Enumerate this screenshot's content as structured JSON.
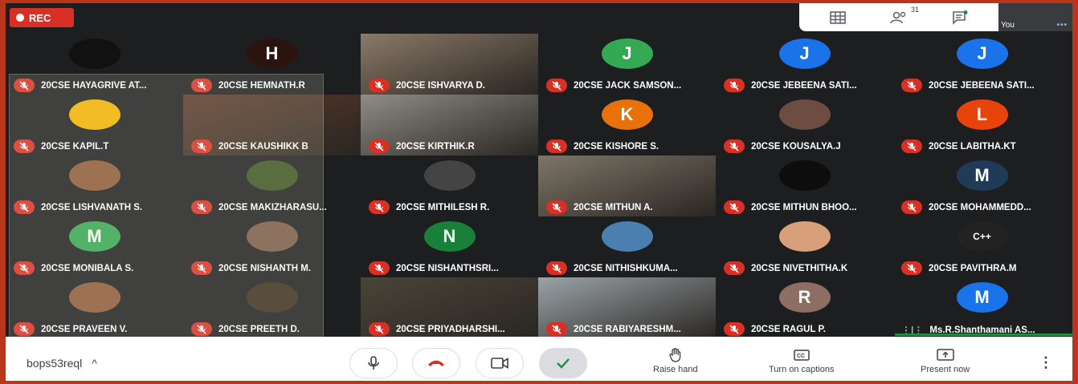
{
  "rec_label": "REC",
  "participant_count": "31",
  "self_label": "You",
  "self_dots": "•••",
  "meeting_code": "bops53reql",
  "chevron": "^",
  "actions": {
    "raise_hand": "Raise hand",
    "captions": "Turn on captions",
    "present": "Present now"
  },
  "tiles": [
    {
      "name": "20CSE HAYAGRIVE AT...",
      "col": 0,
      "row": 0,
      "kind": "avatar",
      "color": "#111111",
      "letter": ""
    },
    {
      "name": "20CSE HEMNATH.R",
      "col": 1,
      "row": 0,
      "kind": "avatar",
      "color": "#2b1410",
      "letter": "H"
    },
    {
      "name": "20CSE ISHVARYA D.",
      "col": 2,
      "row": 0,
      "kind": "video",
      "color": "#8a7a68",
      "letter": ""
    },
    {
      "name": "20CSE JACK SAMSON...",
      "col": 3,
      "row": 0,
      "kind": "avatar",
      "color": "#34a853",
      "letter": "J"
    },
    {
      "name": "20CSE JEBEENA SATI...",
      "col": 4,
      "row": 0,
      "kind": "avatar",
      "color": "#1a73e8",
      "letter": "J"
    },
    {
      "name": "20CSE JEBEENA SATI...",
      "col": 5,
      "row": 0,
      "kind": "avatar",
      "color": "#1a73e8",
      "letter": "J"
    },
    {
      "name": "20CSE KAPIL.T",
      "col": 0,
      "row": 1,
      "kind": "avatar",
      "color": "#f4b400",
      "letter": ""
    },
    {
      "name": "20CSE KAUSHIKK B",
      "col": 1,
      "row": 1,
      "kind": "video",
      "color": "#5c3a2c",
      "letter": ""
    },
    {
      "name": "20CSE KIRTHIK.R",
      "col": 2,
      "row": 1,
      "kind": "video",
      "color": "#8f8d88",
      "letter": ""
    },
    {
      "name": "20CSE KISHORE S.",
      "col": 3,
      "row": 1,
      "kind": "avatar",
      "color": "#e8710a",
      "letter": "K"
    },
    {
      "name": "20CSE KOUSALYA.J",
      "col": 4,
      "row": 1,
      "kind": "avatar",
      "color": "#6d4c41",
      "letter": ""
    },
    {
      "name": "20CSE LABITHA.KT",
      "col": 5,
      "row": 1,
      "kind": "avatar",
      "color": "#e8430a",
      "letter": "L"
    },
    {
      "name": "20CSE LISHVANATH S.",
      "col": 0,
      "row": 2,
      "kind": "avatar",
      "color": "#8d5a3a",
      "letter": ""
    },
    {
      "name": "20CSE MAKIZHARASU...",
      "col": 1,
      "row": 2,
      "kind": "avatar",
      "color": "#3b5323",
      "letter": ""
    },
    {
      "name": "20CSE MITHILESH R.",
      "col": 2,
      "row": 2,
      "kind": "avatar",
      "color": "#444444",
      "letter": ""
    },
    {
      "name": "20CSE MITHUN A.",
      "col": 3,
      "row": 2,
      "kind": "video",
      "color": "#7d7568",
      "letter": ""
    },
    {
      "name": "20CSE MITHUN BHOO...",
      "col": 4,
      "row": 2,
      "kind": "avatar",
      "color": "#0d0d0d",
      "letter": ""
    },
    {
      "name": "20CSE MOHAMMEDD...",
      "col": 5,
      "row": 2,
      "kind": "avatar",
      "color": "#1f3b57",
      "letter": "M"
    },
    {
      "name": "20CSE MONIBALA S.",
      "col": 0,
      "row": 3,
      "kind": "avatar",
      "color": "#34a853",
      "letter": "M"
    },
    {
      "name": "20CSE NISHANTH M.",
      "col": 1,
      "row": 3,
      "kind": "avatar",
      "color": "#7a5a48",
      "letter": ""
    },
    {
      "name": "20CSE NISHANTHSRI...",
      "col": 2,
      "row": 3,
      "kind": "avatar",
      "color": "#188038",
      "letter": "N"
    },
    {
      "name": "20CSE NITHISHKUMA...",
      "col": 3,
      "row": 3,
      "kind": "avatar",
      "color": "#4a7fb0",
      "letter": ""
    },
    {
      "name": "20CSE NIVETHITHA.K",
      "col": 4,
      "row": 3,
      "kind": "avatar",
      "color": "#d8a07a",
      "letter": ""
    },
    {
      "name": "20CSE PAVITHRA.M",
      "col": 5,
      "row": 3,
      "kind": "avatar",
      "color": "#222222",
      "letter": "C++"
    },
    {
      "name": "20CSE PRAVEEN V.",
      "col": 0,
      "row": 4,
      "kind": "avatar",
      "color": "#8d5a3a",
      "letter": ""
    },
    {
      "name": "20CSE PREETH D.",
      "col": 1,
      "row": 4,
      "kind": "avatar",
      "color": "#3b2e1e",
      "letter": ""
    },
    {
      "name": "20CSE PRIYADHARSHI...",
      "col": 2,
      "row": 4,
      "kind": "video",
      "color": "#4a4438",
      "letter": ""
    },
    {
      "name": "20CSE RABIYARESHM...",
      "col": 3,
      "row": 4,
      "kind": "video",
      "color": "#9aa3a8",
      "letter": ""
    },
    {
      "name": "20CSE RAGUL P.",
      "col": 4,
      "row": 4,
      "kind": "avatar",
      "color": "#8d6e63",
      "letter": "R"
    },
    {
      "name": "Ms.R.Shanthamani AS...",
      "col": 5,
      "row": 4,
      "kind": "avatar",
      "color": "#1a73e8",
      "letter": "M",
      "speaking": true
    }
  ]
}
